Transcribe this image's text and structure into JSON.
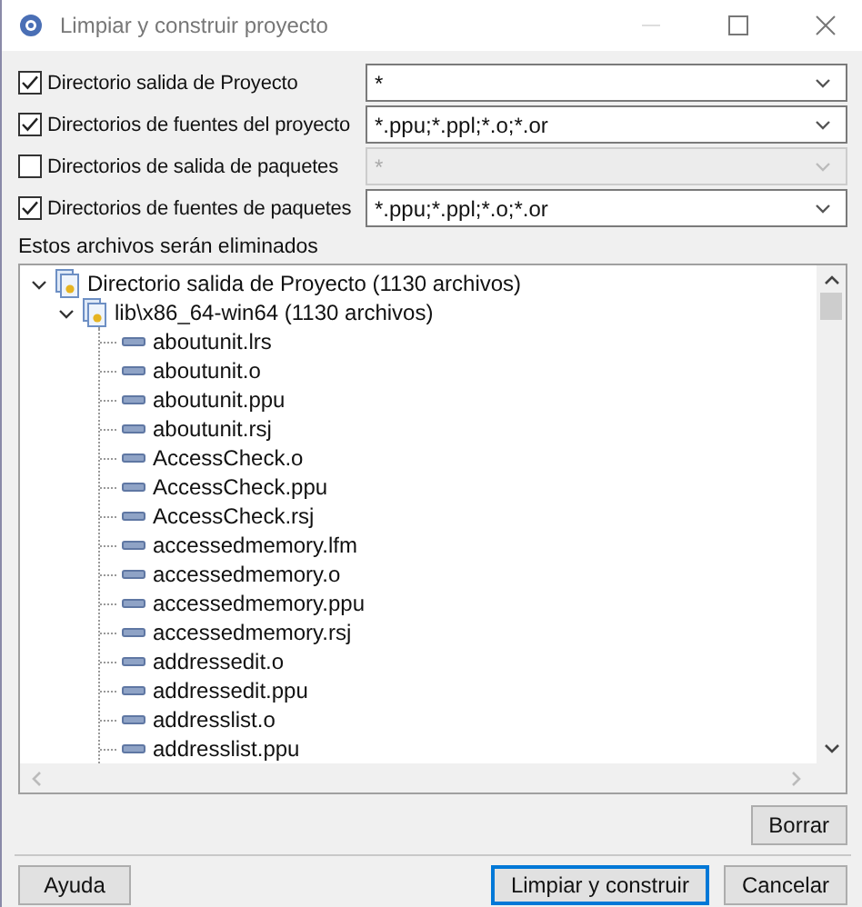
{
  "window": {
    "title": "Limpiar y construir proyecto"
  },
  "options": [
    {
      "label": "Directorio salida de Proyecto",
      "checked": true,
      "value": "*",
      "disabled": false
    },
    {
      "label": "Directorios de fuentes del proyecto",
      "checked": true,
      "value": "*.ppu;*.ppl;*.o;*.or",
      "disabled": false
    },
    {
      "label": "Directorios de salida de paquetes",
      "checked": false,
      "value": "*",
      "disabled": true
    },
    {
      "label": "Directorios de fuentes de paquetes",
      "checked": true,
      "value": "*.ppu;*.ppl;*.o;*.or",
      "disabled": false
    }
  ],
  "tree_label": "Estos archivos serán eliminados",
  "tree": [
    {
      "kind": "folder",
      "label": "Directorio salida de Proyecto (1130 archivos)",
      "expanded": true,
      "children": [
        {
          "kind": "folder",
          "label": "lib\\x86_64-win64 (1130 archivos)",
          "expanded": true,
          "children": [
            {
              "kind": "file",
              "label": "aboutunit.lrs"
            },
            {
              "kind": "file",
              "label": "aboutunit.o"
            },
            {
              "kind": "file",
              "label": "aboutunit.ppu"
            },
            {
              "kind": "file",
              "label": "aboutunit.rsj"
            },
            {
              "kind": "file",
              "label": "AccessCheck.o"
            },
            {
              "kind": "file",
              "label": "AccessCheck.ppu"
            },
            {
              "kind": "file",
              "label": "AccessCheck.rsj"
            },
            {
              "kind": "file",
              "label": "accessedmemory.lfm"
            },
            {
              "kind": "file",
              "label": "accessedmemory.o"
            },
            {
              "kind": "file",
              "label": "accessedmemory.ppu"
            },
            {
              "kind": "file",
              "label": "accessedmemory.rsj"
            },
            {
              "kind": "file",
              "label": "addressedit.o"
            },
            {
              "kind": "file",
              "label": "addressedit.ppu"
            },
            {
              "kind": "file",
              "label": "addresslist.o"
            },
            {
              "kind": "file",
              "label": "addresslist.ppu"
            }
          ]
        }
      ]
    }
  ],
  "delete_button": "Borrar",
  "help_button": "Ayuda",
  "action_buttons": [
    {
      "label": "Limpiar y construir",
      "default": true
    },
    {
      "label": "Cancelar",
      "default": false
    }
  ]
}
